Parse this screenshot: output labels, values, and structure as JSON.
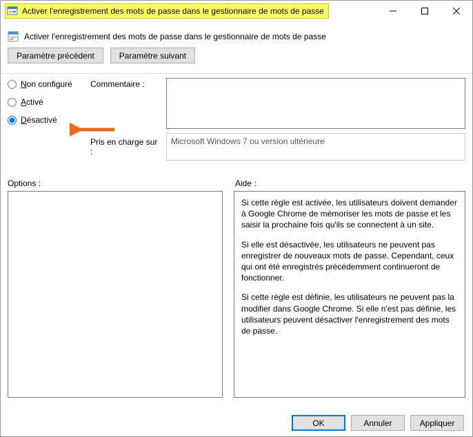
{
  "window": {
    "title": "Activer l'enregistrement des mots de passe dans le gestionnaire de mots de passe"
  },
  "header": {
    "policy_name": "Activer l'enregistrement des mots de passe dans le gestionnaire de mots de passe"
  },
  "nav": {
    "prev": "Paramètre précédent",
    "next": "Paramètre suivant"
  },
  "state": {
    "not_configured_pre": "N",
    "not_configured_rest": "on configuré",
    "enabled_pre": "A",
    "enabled_rest": "ctivé",
    "disabled_pre": "D",
    "disabled_rest": "ésactivé",
    "selected": "disabled"
  },
  "labels": {
    "comment": "Commentaire :",
    "supported_on": "Pris en charge sur :",
    "options": "Options :",
    "help": "Aide :"
  },
  "fields": {
    "comment_value": "",
    "supported_on_value": "Microsoft Windows 7 ou version ultérieure"
  },
  "help": {
    "p1": "Si cette règle est activée, les utilisateurs doivent demander à Google Chrome de mémoriser les mots de passe et les saisir la prochaine fois qu'ils se connectent à un site.",
    "p2": "Si elle est désactivée, les utilisateurs ne peuvent pas enregistrer de nouveaux mots de passe. Cependant, ceux qui ont été enregistrés précédemment continueront de fonctionner.",
    "p3": "Si cette règle est définie, les utilisateurs ne peuvent pas la modifier dans Google Chrome. Si elle n'est pas définie, les utilisateurs peuvent désactiver l'enregistrement des mots de passe."
  },
  "footer": {
    "ok": "OK",
    "cancel": "Annuler",
    "apply": "Appliquer"
  }
}
